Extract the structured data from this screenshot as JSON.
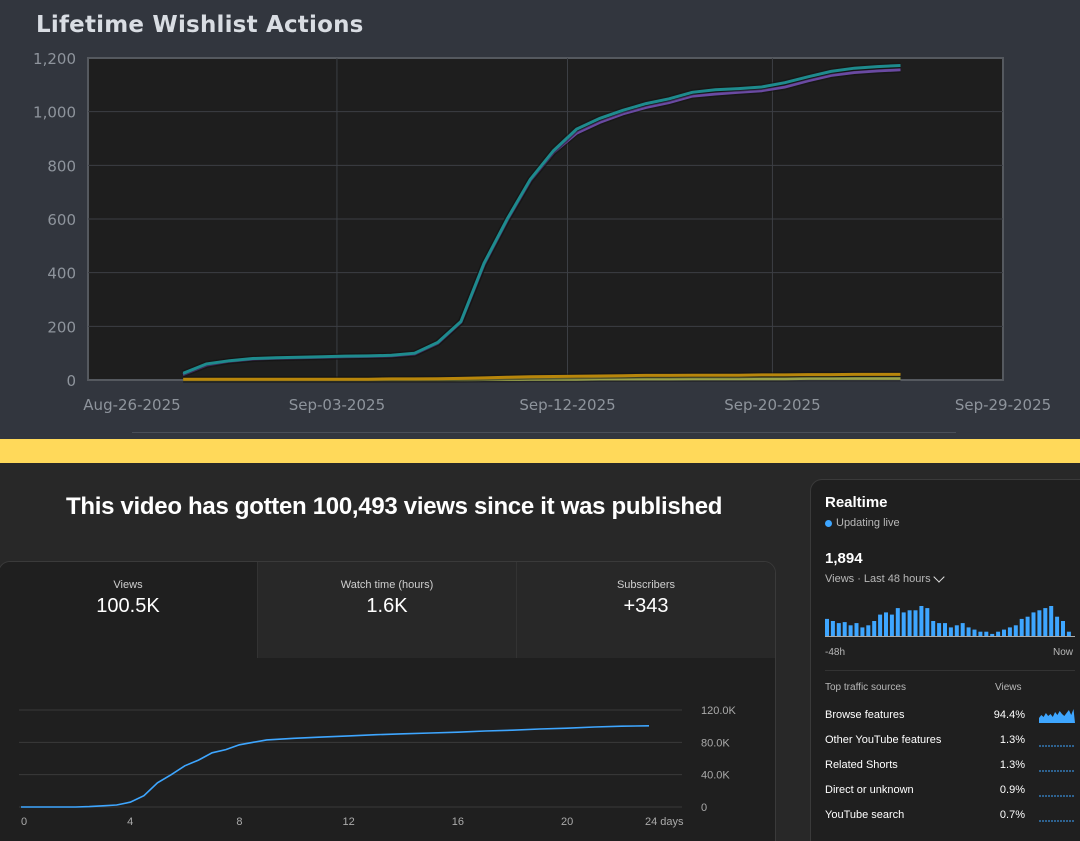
{
  "chart_data": [
    {
      "type": "line",
      "title": "Lifetime Wishlist Actions",
      "x_tick_labels": [
        "Aug-26-2025",
        "Sep-03-2025",
        "Sep-12-2025",
        "Sep-20-2025",
        "Sep-29-2025"
      ],
      "y_tick_labels": [
        "0",
        "200",
        "400",
        "600",
        "800",
        "1,000",
        "1,200"
      ],
      "ylim": [
        0,
        1200
      ],
      "grid": true,
      "x": [
        "2025-08-28",
        "2025-08-29",
        "2025-08-30",
        "2025-08-31",
        "2025-09-01",
        "2025-09-02",
        "2025-09-03",
        "2025-09-04",
        "2025-09-05",
        "2025-09-06",
        "2025-09-07",
        "2025-09-08",
        "2025-09-09",
        "2025-09-10",
        "2025-09-11",
        "2025-09-12",
        "2025-09-13",
        "2025-09-14",
        "2025-09-15",
        "2025-09-16",
        "2025-09-17",
        "2025-09-18",
        "2025-09-19",
        "2025-09-20",
        "2025-09-21",
        "2025-09-22",
        "2025-09-23",
        "2025-09-24",
        "2025-09-25"
      ],
      "series": [
        {
          "color": "#1e8b8e",
          "values": [
            25,
            60,
            72,
            80,
            83,
            85,
            87,
            89,
            90,
            92,
            100,
            140,
            218,
            435,
            600,
            748,
            855,
            935,
            975,
            1005,
            1030,
            1048,
            1072,
            1082,
            1086,
            1092,
            1108,
            1130,
            1150,
            1162,
            1168,
            1172
          ]
        },
        {
          "color": "#6a4aa2",
          "values": [
            20,
            55,
            70,
            78,
            81,
            83,
            85,
            87,
            88,
            90,
            97,
            137,
            215,
            430,
            595,
            743,
            848,
            920,
            960,
            992,
            1016,
            1034,
            1058,
            1066,
            1072,
            1078,
            1092,
            1115,
            1135,
            1146,
            1152,
            1156
          ]
        },
        {
          "color": "#b8860b",
          "values": [
            3,
            3,
            3,
            3,
            3,
            3,
            3,
            3,
            3,
            4,
            4,
            5,
            6,
            8,
            10,
            12,
            13,
            14,
            15,
            16,
            17,
            17,
            18,
            18,
            18,
            19,
            19,
            20,
            20,
            21,
            21,
            21
          ]
        },
        {
          "color": "#9aa34a",
          "values": [
            1,
            1,
            1,
            1,
            1,
            1,
            1,
            1,
            1,
            1,
            1,
            1,
            1,
            2,
            2,
            3,
            3,
            3,
            4,
            4,
            4,
            4,
            5,
            5,
            5,
            5,
            5,
            6,
            6,
            6,
            6,
            6
          ]
        }
      ]
    },
    {
      "type": "line",
      "title": "",
      "x": [
        0,
        1,
        2,
        2.5,
        3,
        3.5,
        4,
        4.5,
        5,
        5.5,
        6,
        6.5,
        7,
        7.5,
        8,
        8.5,
        9,
        10,
        11,
        12,
        13,
        14,
        15,
        16,
        17,
        18,
        19,
        20,
        21,
        22,
        23
      ],
      "x_tick_labels": [
        "0",
        "4",
        "8",
        "12",
        "16",
        "20",
        "24 days"
      ],
      "y_tick_labels": [
        "0",
        "40.0K",
        "80.0K",
        "120.0K"
      ],
      "ylim": [
        0,
        120000
      ],
      "series": [
        {
          "color": "#3ea6ff",
          "values": [
            0,
            0,
            0,
            500,
            1500,
            2500,
            6000,
            14000,
            30000,
            40000,
            51000,
            58000,
            67000,
            71000,
            77000,
            80000,
            83000,
            85000,
            86500,
            88000,
            89500,
            90500,
            91500,
            92500,
            94000,
            95000,
            96500,
            97500,
            99000,
            100000,
            100493
          ]
        }
      ]
    }
  ],
  "youtube": {
    "headline": "This video has gotten 100,493 views since it was published",
    "metrics": [
      {
        "label": "Views",
        "value": "100.5K"
      },
      {
        "label": "Watch time (hours)",
        "value": "1.6K"
      },
      {
        "label": "Subscribers",
        "value": "+343"
      }
    ],
    "realtime": {
      "title": "Realtime",
      "status": "Updating live",
      "count": "1,894",
      "subtitle": "Views · Last 48 hours",
      "axis_left": "-48h",
      "axis_right": "Now",
      "bars": [
        16,
        14,
        12,
        13,
        10,
        12,
        8,
        10,
        14,
        20,
        22,
        20,
        26,
        22,
        24,
        24,
        28,
        26,
        14,
        12,
        12,
        8,
        10,
        12,
        8,
        6,
        4,
        4,
        2,
        4,
        6,
        8,
        10,
        16,
        18,
        22,
        24,
        26,
        28,
        18,
        14,
        4
      ],
      "accent_color": "#3ea6ff"
    },
    "sources": {
      "header_left": "Top traffic sources",
      "header_right": "Views",
      "rows": [
        {
          "name": "Browse features",
          "pct": "94.4%"
        },
        {
          "name": "Other YouTube features",
          "pct": "1.3%"
        },
        {
          "name": "Related Shorts",
          "pct": "1.3%"
        },
        {
          "name": "Direct or unknown",
          "pct": "0.9%"
        },
        {
          "name": "YouTube search",
          "pct": "0.7%"
        }
      ]
    }
  }
}
